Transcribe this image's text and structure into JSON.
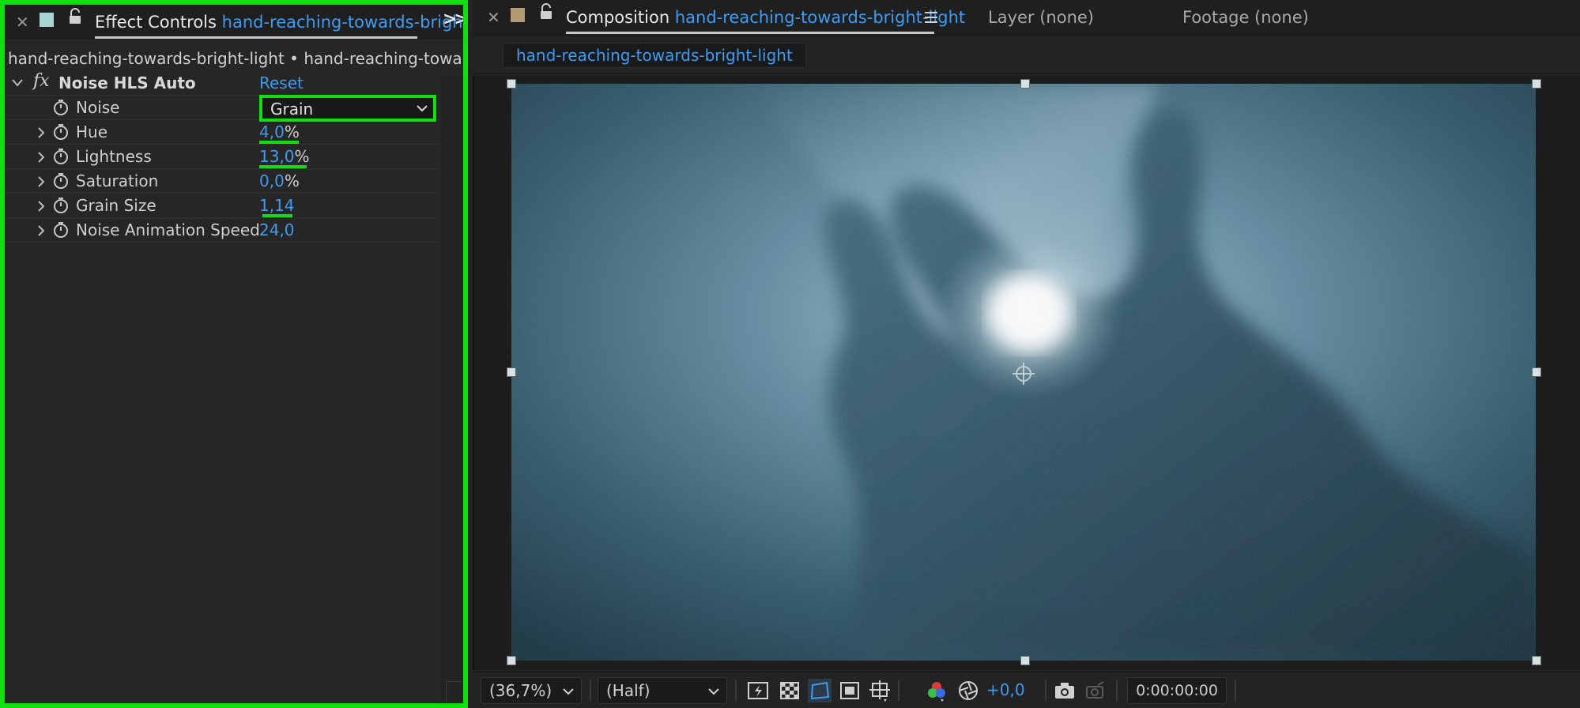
{
  "effect_controls": {
    "tab_label": "Effect Controls",
    "tab_layer": "hand-reaching-towards-brigh",
    "breadcrumb": "hand-reaching-towards-bright-light • hand-reaching-towards-bri",
    "effect": {
      "name": "Noise HLS Auto",
      "reset_label": "Reset",
      "noise": {
        "label": "Noise",
        "value": "Grain"
      },
      "properties": [
        {
          "label": "Hue",
          "value": "4,0",
          "unit": "%"
        },
        {
          "label": "Lightness",
          "value": "13,0",
          "unit": "%"
        },
        {
          "label": "Saturation",
          "value": "0,0",
          "unit": "%"
        },
        {
          "label": "Grain Size",
          "value": "1,14",
          "unit": ""
        },
        {
          "label": "Noise Animation Speed",
          "value": "24,0",
          "unit": ""
        }
      ]
    },
    "highlight_color": "#10e010"
  },
  "composition": {
    "tab_label": "Composition",
    "tab_name": "hand-reaching-towards-bright-light",
    "layer_tab": "Layer (none)",
    "footage_tab": "Footage (none)",
    "subtab": "hand-reaching-towards-bright-light",
    "toolbar": {
      "zoom": "(36,7%)",
      "resolution": "(Half)",
      "exposure": "+0,0",
      "timecode": "0:00:00:00"
    }
  },
  "colors": {
    "accent_blue": "#3f9bf0",
    "panel_bg": "#262626",
    "highlight_green": "#10e010"
  }
}
